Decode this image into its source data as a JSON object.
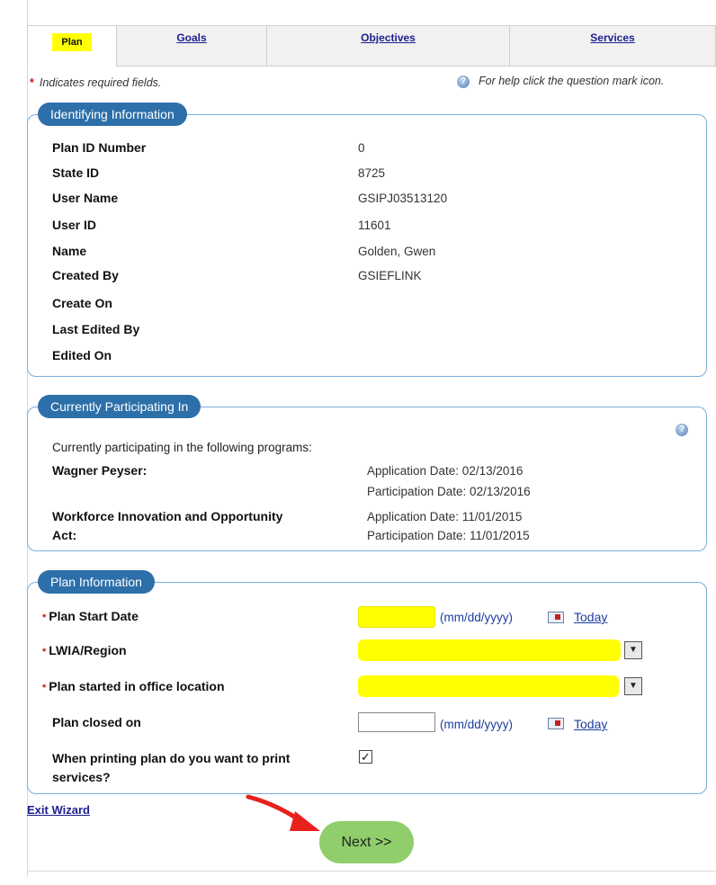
{
  "tabs": [
    {
      "label": "Plan",
      "active": true
    },
    {
      "label": "Goals",
      "active": false
    },
    {
      "label": "Objectives",
      "active": false
    },
    {
      "label": "Services",
      "active": false
    }
  ],
  "required_note": "Indicates required fields.",
  "help_note": "For help click the question mark icon.",
  "identifying": {
    "title": "Identifying Information",
    "rows": [
      {
        "label": "Plan ID Number",
        "value": "0"
      },
      {
        "label": "State ID",
        "value": "8725"
      },
      {
        "label": "User Name",
        "value": "GSIPJ03513120"
      },
      {
        "label": "User ID",
        "value": "11601"
      },
      {
        "label": "Name",
        "value": "Golden, Gwen"
      },
      {
        "label": "Created By",
        "value": "GSIEFLINK"
      },
      {
        "label": "Create On",
        "value": ""
      },
      {
        "label": "Last Edited By",
        "value": ""
      },
      {
        "label": "Edited On",
        "value": ""
      }
    ]
  },
  "participating": {
    "title": "Currently Participating In",
    "intro": "Currently participating in the following programs:",
    "programs": [
      {
        "name": "Wagner Peyser:",
        "application": "Application Date: 02/13/2016",
        "participation": "Participation Date: 02/13/2016"
      },
      {
        "name_line1": "Workforce Innovation and Opportunity",
        "name_line2": "Act:",
        "application": "Application Date: 11/01/2015",
        "participation": "Participation Date: 11/01/2015"
      }
    ]
  },
  "plan_info": {
    "title": "Plan Information",
    "start_date_label": "Plan Start Date",
    "region_label": "LWIA/Region",
    "office_label": "Plan started in office location",
    "closed_label": "Plan closed on",
    "print_label_line1": "When printing plan do you want to print",
    "print_label_line2": "services?",
    "date_format": "(mm/dd/yyyy)",
    "today": "Today",
    "start_date_value": "",
    "closed_value": "",
    "print_services_checked": true,
    "check_mark": "✓"
  },
  "exit_wizard": "Exit Wizard",
  "next_button": "Next >>",
  "colors": {
    "highlight": "#ffff00",
    "legend": "#2d6fa9",
    "next": "#8fce6a",
    "required": "#d01010"
  }
}
